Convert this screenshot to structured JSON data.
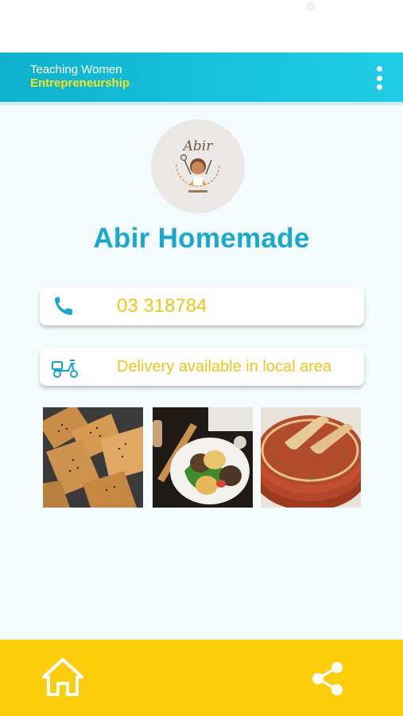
{
  "header": {
    "brand_line1": "Teaching Women",
    "brand_line2": "Entrepreneurship",
    "menu_icon": "more-vert-icon"
  },
  "profile": {
    "logo_text": "Abir",
    "title": "Abir Homemade"
  },
  "contact": {
    "phone": "03 318784",
    "phone_icon": "phone-icon",
    "delivery": "Delivery available in local area",
    "delivery_icon": "scooter-icon"
  },
  "gallery": [
    "pastries-photo",
    "kibbeh-plate-photo",
    "lahm-bi-ajeen-photo"
  ],
  "bottom_nav": {
    "home_icon": "home-icon",
    "share_icon": "share-icon"
  },
  "colors": {
    "header": "#19c1db",
    "title": "#19a9cc",
    "accent_text": "#f2c41a",
    "bottom_bar": "#fccd0b",
    "brand_yellow": "#f5e51e"
  }
}
